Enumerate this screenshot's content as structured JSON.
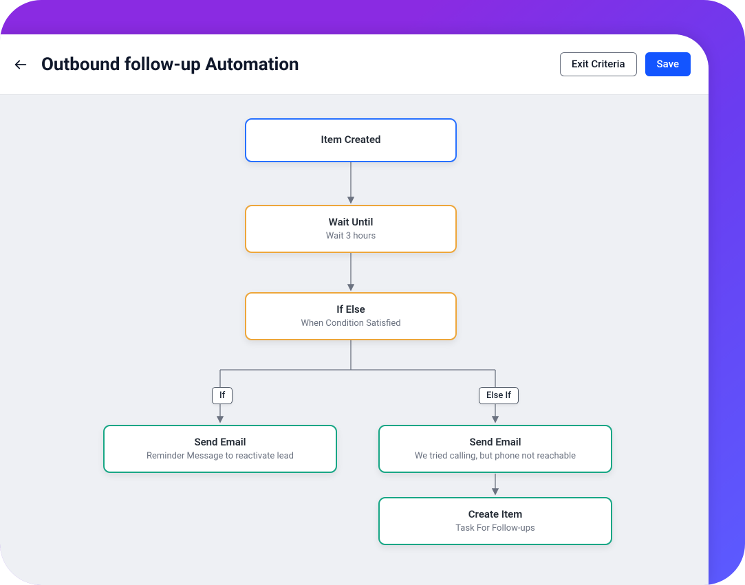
{
  "header": {
    "title": "Outbound follow-up Automation",
    "exit_criteria": "Exit Criteria",
    "save": "Save"
  },
  "nodes": {
    "trigger": {
      "title": "Item Created"
    },
    "wait": {
      "title": "Wait Until",
      "subtitle": "Wait 3 hours"
    },
    "ifelse": {
      "title": "If Else",
      "subtitle": "When Condition Satisfied"
    },
    "branch_if": {
      "label": "If"
    },
    "branch_elseif": {
      "label": "Else If"
    },
    "email_if": {
      "title": "Send Email",
      "subtitle": "Reminder Message to reactivate lead"
    },
    "email_elseif": {
      "title": "Send Email",
      "subtitle": "We tried calling, but phone not reachable"
    },
    "create_item": {
      "title": "Create Item",
      "subtitle": "Task For Follow-ups"
    }
  }
}
